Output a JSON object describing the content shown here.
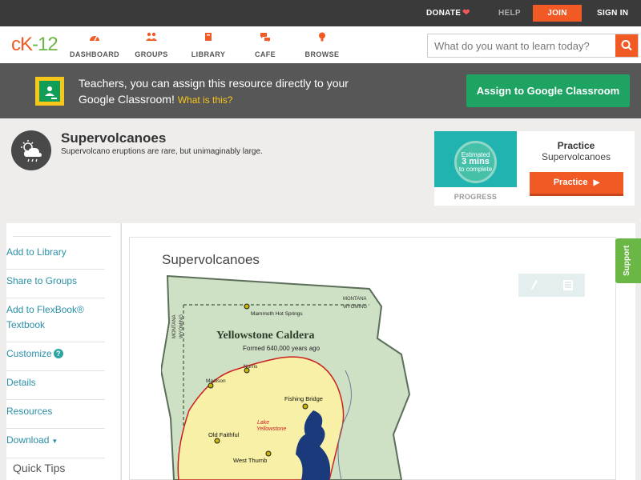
{
  "topbar": {
    "donate": "DONATE",
    "help": "HELP",
    "join": "JOIN",
    "signin": "SIGN IN"
  },
  "nav": {
    "logo_a": "cK",
    "logo_b": "-12",
    "items": [
      {
        "label": "DASHBOARD",
        "icon": "dashboard-icon"
      },
      {
        "label": "GROUPS",
        "icon": "groups-icon"
      },
      {
        "label": "LIBRARY",
        "icon": "library-icon"
      },
      {
        "label": "CAFE",
        "icon": "cafe-icon"
      },
      {
        "label": "BROWSE",
        "icon": "browse-icon"
      }
    ],
    "search_placeholder": "What do you want to learn today?"
  },
  "banner": {
    "text": "Teachers, you can assign this resource directly to your Google Classroom!",
    "what_link": "What is this?",
    "assign_button": "Assign to Google Classroom"
  },
  "header": {
    "title": "Supervolcanoes",
    "subtitle": "Supervolcano eruptions are rare, but unimaginably large."
  },
  "practice": {
    "estimated": "Estimated",
    "mins": "3 mins",
    "to_complete": "to complete",
    "progress_label": "PROGRESS",
    "title": "Practice",
    "subtitle": "Supervolcanoes",
    "button": "Practice"
  },
  "sidebar": {
    "items": [
      {
        "label": "Add to Library"
      },
      {
        "label": "Share to Groups"
      },
      {
        "label": "Add to FlexBook® Textbook"
      },
      {
        "label": "Customize"
      },
      {
        "label": "Details"
      },
      {
        "label": "Resources"
      },
      {
        "label": "Download"
      }
    ],
    "quick_tips": "Quick Tips"
  },
  "content": {
    "title": "Supervolcanoes"
  },
  "map": {
    "title": "Yellowstone Caldera",
    "subtitle": "Formed 640,000 years ago",
    "state_top": "MONTANA",
    "state_top2": "WYOMING",
    "state_left": "MONTANA",
    "state_left2": "WYOMING",
    "places": [
      "Mammoth Hot Springs",
      "Norris",
      "Madison",
      "Fishing Bridge",
      "Old Faithful",
      "West Thumb"
    ],
    "lake_a": "Lake",
    "lake_b": "Yellowstone"
  },
  "support": "Support",
  "colors": {
    "accent_orange": "#f15a24",
    "green": "#1ea362",
    "link": "#2a8fa7"
  }
}
